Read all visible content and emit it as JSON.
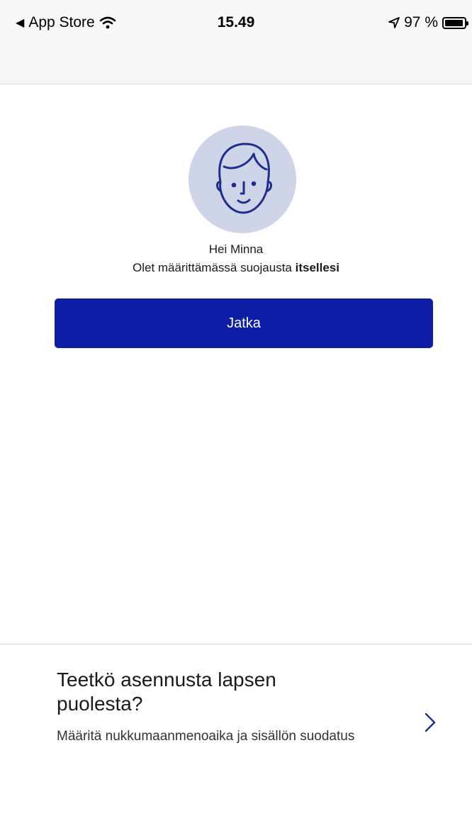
{
  "status_bar": {
    "back_app": "App Store",
    "time": "15.49",
    "battery_text": "97 %",
    "battery_level": 0.97
  },
  "main": {
    "greeting": "Hei Minna",
    "subtitle_prefix": "Olet määrittämässä suojausta ",
    "subtitle_bold": "itsellesi",
    "continue_label": "Jatka"
  },
  "child_option": {
    "title": "Teetkö asennusta lapsen puolesta?",
    "description": "Määritä nukkumaanmenoaika ja sisällön suodatus"
  },
  "colors": {
    "primary": "#0d1ea6",
    "avatar_bg": "#cfd5e8",
    "icon_stroke": "#1f2d8f"
  },
  "icons": {
    "back": "back-triangle-icon",
    "wifi": "wifi-icon",
    "location": "location-arrow-icon",
    "battery": "battery-icon",
    "avatar": "person-face-icon",
    "chevron": "chevron-right-icon"
  }
}
